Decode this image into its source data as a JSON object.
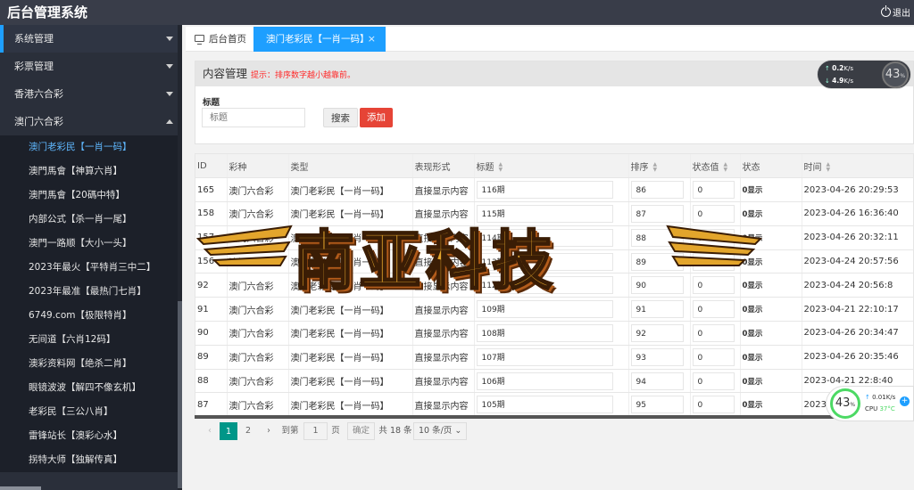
{
  "app": {
    "title": "后台管理系统",
    "logout": "退出"
  },
  "sidebar": {
    "menus": [
      {
        "label": "系统管理"
      },
      {
        "label": "彩票管理"
      },
      {
        "label": "香港六合彩"
      },
      {
        "label": "澳门六合彩"
      }
    ],
    "submenu": [
      "澳门老彩民【一肖一码】",
      "澳門馬會【神算六肖】",
      "澳門馬會【20碼中特】",
      "内部公式【杀一肖一尾】",
      "澳門一路顺【大小一头】",
      "2023年最火【平特肖三中二】",
      "2023年最准【最热门七肖】",
      "6749.com【极限特肖】",
      "无间道【六肖12码】",
      "澳彩资料网【绝杀二肖】",
      "眼镜波波【解四不像玄机】",
      "老彩民【三公八肖】",
      "雷锋站长【澳彩心水】",
      "拐特大师【独解传真】"
    ]
  },
  "tabs": {
    "home": "后台首页",
    "current": "澳门老彩民【一肖一码】",
    "close": "×"
  },
  "panel": {
    "title": "内容管理",
    "hint": "提示：排序数字越小越靠前。",
    "field_label": "标题",
    "field_placeholder": "标题",
    "search": "搜索",
    "add": "添加"
  },
  "table": {
    "headers": [
      "ID",
      "彩种",
      "类型",
      "表现形式",
      "标题",
      "排序",
      "状态值",
      "状态",
      "时间"
    ],
    "rows": [
      [
        "165",
        "澳门六合彩",
        "澳门老彩民【一肖一码】",
        "直接显示内容",
        "116期",
        "86",
        "0",
        "0显示",
        "2023-04-26 20:29:53"
      ],
      [
        "158",
        "澳门六合彩",
        "澳门老彩民【一肖一码】",
        "直接显示内容",
        "115期",
        "87",
        "0",
        "0显示",
        "2023-04-26 16:36:40"
      ],
      [
        "157",
        "澳门六合彩",
        "澳门老彩民【一肖一码】",
        "直接显示内容",
        "114期",
        "88",
        "0",
        "0显示",
        "2023-04-26 20:32:11"
      ],
      [
        "156",
        "澳门六合彩",
        "澳门老彩民【一肖一码】",
        "直接显示内容",
        "113期",
        "89",
        "0",
        "0显示",
        "2023-04-24 20:57:56"
      ],
      [
        "92",
        "澳门六合彩",
        "澳门老彩民【一肖一码】",
        "直接显示内容",
        "112期",
        "90",
        "0",
        "0显示",
        "2023-04-24 20:56:8"
      ],
      [
        "91",
        "澳门六合彩",
        "澳门老彩民【一肖一码】",
        "直接显示内容",
        "109期",
        "91",
        "0",
        "0显示",
        "2023-04-21 22:10:17"
      ],
      [
        "90",
        "澳门六合彩",
        "澳门老彩民【一肖一码】",
        "直接显示内容",
        "108期",
        "92",
        "0",
        "0显示",
        "2023-04-26 20:34:47"
      ],
      [
        "89",
        "澳门六合彩",
        "澳门老彩民【一肖一码】",
        "直接显示内容",
        "107期",
        "93",
        "0",
        "0显示",
        "2023-04-26 20:35:46"
      ],
      [
        "88",
        "澳门六合彩",
        "澳门老彩民【一肖一码】",
        "直接显示内容",
        "106期",
        "94",
        "0",
        "0显示",
        "2023-04-21 22:8:40"
      ],
      [
        "87",
        "澳门六合彩",
        "澳门老彩民【一肖一码】",
        "直接显示内容",
        "105期",
        "95",
        "0",
        "0显示",
        "2023-04-21 22:7:20"
      ]
    ]
  },
  "pager": {
    "prev": "‹",
    "pages": [
      "1",
      "2"
    ],
    "next": "›",
    "goto": "到第",
    "page_value": "1",
    "page_unit": "页",
    "confirm": "确定",
    "total": "共 18 条",
    "per_page": "10 条/页 ⌄"
  },
  "watermark": {
    "text": "南亚科技"
  },
  "net_widget": {
    "up": "0.2",
    "down": "4.9",
    "unit": "K/s",
    "percent": "43",
    "pct": "%"
  },
  "cpu_widget": {
    "percent": "43",
    "pct": "%",
    "speed": "0.01K/s",
    "cpu_label": "CPU",
    "temp": "37°C"
  },
  "colors": {
    "header": "#393d49",
    "sidebar": "#2a2f3a",
    "accent": "#1e9fff",
    "add": "#e64436",
    "pager_active": "#009688"
  }
}
